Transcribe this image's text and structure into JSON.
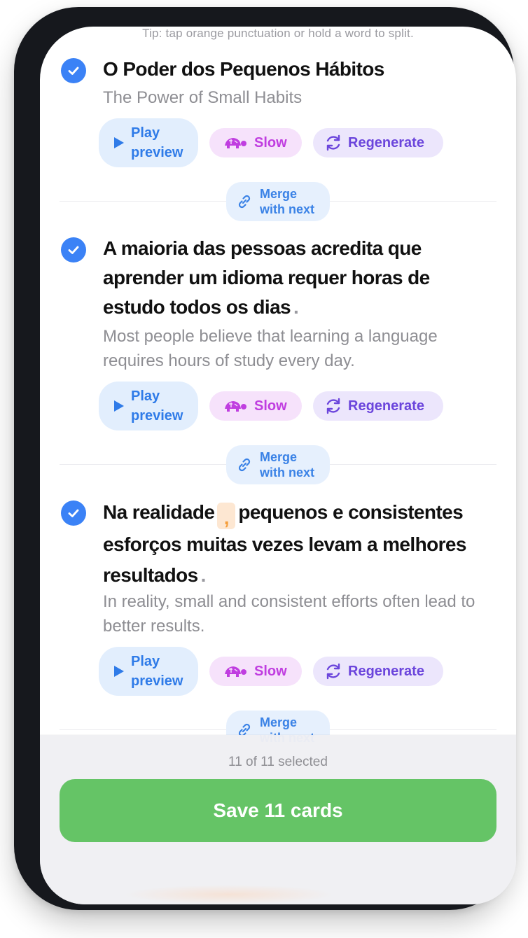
{
  "tip": "Tip: tap orange punctuation or hold a word to split.",
  "actions": {
    "play_label": "Play\npreview",
    "slow_label": "Slow",
    "regenerate_label": "Regenerate",
    "merge_label": "Merge\nwith next"
  },
  "sentences": [
    {
      "original": "O Poder dos Pequenos Hábitos",
      "translation": "The Power of Small Habits",
      "selected": true
    },
    {
      "original": "A maioria das pessoas acredita que aprender um idioma requer horas de estudo todos os dias",
      "end_punct": ".",
      "translation": "Most people believe that learning a language requires hours of study every day.",
      "selected": true
    },
    {
      "original_a": "Na realidade",
      "split_punct": ",",
      "original_b": "pequenos e consistentes esforços muitas vezes levam a melhores resultados",
      "end_punct": ".",
      "translation": "In reality, small and consistent efforts often lead to better results.",
      "selected": true
    }
  ],
  "footer": {
    "selected_count": "11 of 11 selected",
    "save_label": "Save 11 cards"
  },
  "colors": {
    "check": "#3b82f6",
    "save": "#65c466",
    "slow": "#c03ee0",
    "regenerate": "#6b45dc",
    "play": "#2f7be8",
    "split_punct": "#f59e3b"
  },
  "icons": [
    "checkmark-icon",
    "play-icon",
    "turtle-icon",
    "refresh-icon",
    "link-icon"
  ]
}
